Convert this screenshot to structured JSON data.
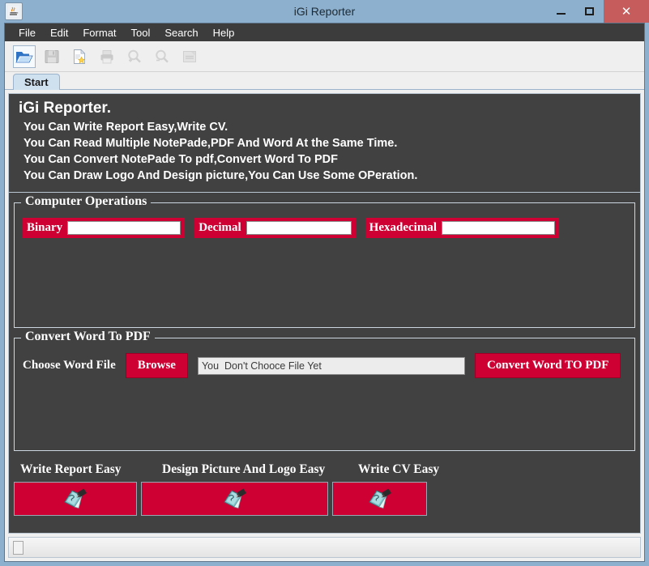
{
  "window": {
    "title": "iGi Reporter",
    "app_icon": "java-coffee-cup-icon",
    "buttons": {
      "minimize": "minimize-icon",
      "maximize": "maximize-icon",
      "close": "✕"
    }
  },
  "menubar": {
    "items": [
      {
        "label": "File"
      },
      {
        "label": "Edit"
      },
      {
        "label": "Format"
      },
      {
        "label": "Tool"
      },
      {
        "label": "Search"
      },
      {
        "label": "Help"
      }
    ]
  },
  "toolbar": {
    "items": [
      {
        "icon": "open-folder-icon",
        "enabled": true,
        "selected": true
      },
      {
        "icon": "save-floppy-icon",
        "enabled": false,
        "selected": false
      },
      {
        "icon": "new-document-icon",
        "enabled": true,
        "selected": false
      },
      {
        "icon": "print-icon",
        "enabled": false,
        "selected": false
      },
      {
        "icon": "zoom-in-icon",
        "enabled": false,
        "selected": false
      },
      {
        "icon": "zoom-out-icon",
        "enabled": false,
        "selected": false
      },
      {
        "icon": "save-as-icon",
        "enabled": false,
        "selected": false
      }
    ]
  },
  "tabs": [
    {
      "label": "Start",
      "selected": true
    }
  ],
  "intro": {
    "headline": "iGi Reporter.",
    "lines": [
      "You Can Write Report Easy,Write  CV.",
      "You Can Read Multiple NotePade,PDF And Word At the Same Time.",
      "You Can Convert NotePade To pdf,Convert Word To PDF",
      "You Can Draw Logo And Design picture,You Can Use Some OPeration."
    ]
  },
  "computer_operations": {
    "title": "Computer Operations",
    "fields": [
      {
        "label": "Binary",
        "value": "",
        "placeholder": ""
      },
      {
        "label": "Decimal",
        "value": "",
        "placeholder": ""
      },
      {
        "label": "Hexadecimal",
        "value": "",
        "placeholder": ""
      }
    ]
  },
  "convert_word": {
    "title": "Convert Word To PDF",
    "choose_label": "Choose Word File",
    "browse_label": "Browse",
    "file_path_value": "You  Don't Chooce File Yet",
    "convert_label": "Convert Word TO PDF"
  },
  "shortcuts": {
    "labels": [
      "Write Report Easy",
      "Design Picture  And Logo Easy",
      "Write CV Easy"
    ],
    "button_icon": "notepad-pencil-icon"
  },
  "statusbar": {
    "grip": "resize-grip"
  },
  "colors": {
    "accent_red": "#ce0033",
    "panel_dark": "#414141",
    "titlebar_blue": "#8cb0ce",
    "close_red": "#c75c5c",
    "tab_selected": "#cfe0ef"
  }
}
